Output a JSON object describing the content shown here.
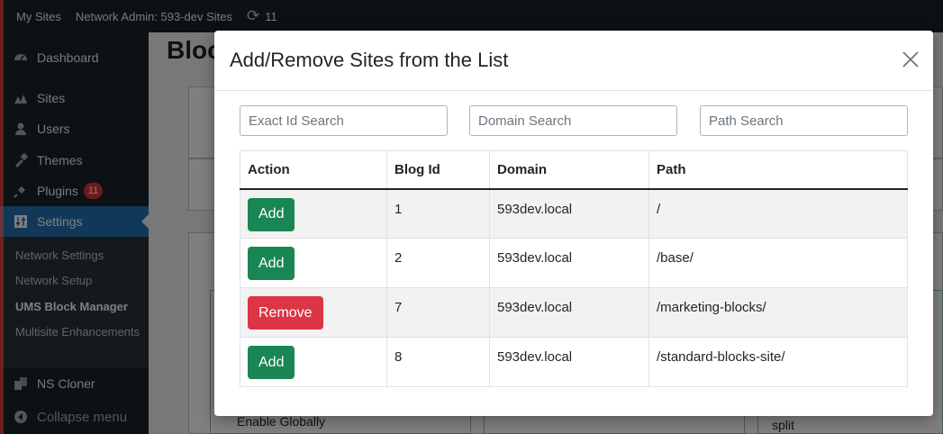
{
  "adminbar": {
    "my_sites": "My Sites",
    "network_admin": "Network Admin: 593-dev Sites",
    "updates_count": "11"
  },
  "sidebar": {
    "items": [
      {
        "label": "Dashboard",
        "icon": "dashboard-icon"
      },
      {
        "label": "Sites",
        "icon": "sites-icon"
      },
      {
        "label": "Users",
        "icon": "users-icon"
      },
      {
        "label": "Themes",
        "icon": "themes-icon"
      },
      {
        "label": "Plugins",
        "icon": "plugins-icon",
        "badge": "11"
      },
      {
        "label": "Settings",
        "icon": "settings-icon"
      },
      {
        "label": "NS Cloner",
        "icon": "ns-cloner-icon"
      },
      {
        "label": "Collapse menu",
        "icon": "collapse-icon"
      }
    ],
    "submenu": [
      "Network Settings",
      "Network Setup",
      "UMS Block Manager",
      "Multisite Enhancements"
    ]
  },
  "background": {
    "title_fragment": "Bloc",
    "enable_globally": "Enable Globally",
    "split": "split"
  },
  "modal": {
    "title": "Add/Remove Sites from the List",
    "search": {
      "id_placeholder": "Exact Id Search",
      "domain_placeholder": "Domain Search",
      "path_placeholder": "Path Search"
    },
    "table": {
      "headers": [
        "Action",
        "Blog Id",
        "Domain",
        "Path"
      ],
      "rows": [
        {
          "action": "Add",
          "blog_id": "1",
          "domain": "593dev.local",
          "path": "/"
        },
        {
          "action": "Add",
          "blog_id": "2",
          "domain": "593dev.local",
          "path": "/base/"
        },
        {
          "action": "Remove",
          "blog_id": "7",
          "domain": "593dev.local",
          "path": "/marketing-blocks/"
        },
        {
          "action": "Add",
          "blog_id": "8",
          "domain": "593dev.local",
          "path": "/standard-blocks-site/"
        }
      ]
    }
  },
  "colors": {
    "add": "#198754",
    "remove": "#dc3545",
    "admin_dark": "#1d2327",
    "active_blue": "#2271b1"
  }
}
